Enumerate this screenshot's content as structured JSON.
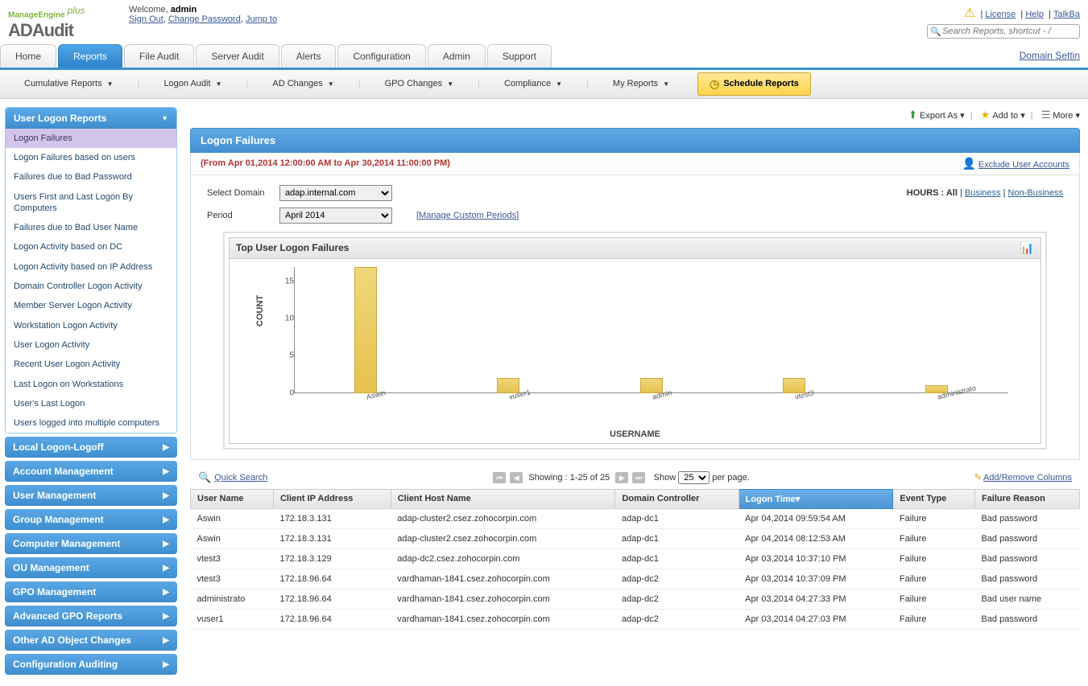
{
  "header": {
    "logo_top": "ManageEngine",
    "logo_main": "ADAudit",
    "logo_plus": "plus",
    "welcome_prefix": "Welcome, ",
    "welcome_user": "admin",
    "sign_out": "Sign Out",
    "change_pw": "Change Password",
    "jump_to": "Jump to",
    "top_links": {
      "license": "License",
      "help": "Help",
      "talkback": "TalkBa"
    },
    "search_placeholder": "Search Reports, shortcut - /"
  },
  "main_tabs": {
    "items": [
      "Home",
      "Reports",
      "File Audit",
      "Server Audit",
      "Alerts",
      "Configuration",
      "Admin",
      "Support"
    ],
    "active_index": 1,
    "right_link": "Domain Settin"
  },
  "sub_toolbar": {
    "items": [
      "Cumulative Reports",
      "Logon Audit",
      "AD Changes",
      "GPO Changes",
      "Compliance",
      "My Reports"
    ],
    "schedule": "Schedule Reports"
  },
  "sidebar": {
    "main_head": "User Logon Reports",
    "items": [
      "Logon Failures",
      "Logon Failures based on users",
      "Failures due to Bad Password",
      "Users First and Last Logon By Computers",
      "Failures due to Bad User Name",
      "Logon Activity based on DC",
      "Logon Activity based on IP Address",
      "Domain Controller Logon Activity",
      "Member Server Logon Activity",
      "Workstation Logon Activity",
      "User Logon Activity",
      "Recent User Logon Activity",
      "Last Logon on Workstations",
      "User's Last Logon",
      "Users logged into multiple computers"
    ],
    "active_index": 0,
    "cats": [
      "Local Logon-Logoff",
      "Account Management",
      "User Management",
      "Group Management",
      "Computer Management",
      "OU Management",
      "GPO Management",
      "Advanced GPO Reports",
      "Other AD Object Changes",
      "Configuration Auditing"
    ]
  },
  "top_actions": {
    "export": "Export As",
    "addto": "Add to",
    "more": "More"
  },
  "content": {
    "title": "Logon Failures",
    "range": "(From Apr 01,2014 12:00:00 AM to Apr 30,2014 11:00:00 PM)",
    "exclude": "Exclude User Accounts"
  },
  "filters": {
    "domain_label": "Select Domain",
    "domain_value": "adap.internal.com",
    "period_label": "Period",
    "period_value": "April 2014",
    "mcp": "[Manage Custom Periods]",
    "hours_prefix": "HOURS : All",
    "business": "Business",
    "nonbusiness": "Non-Business"
  },
  "chart_data": {
    "type": "bar",
    "title": "Top User Logon Failures",
    "xlabel": "USERNAME",
    "ylabel": "COUNT",
    "ylim": [
      0,
      17
    ],
    "y_ticks": [
      0,
      5,
      10,
      15
    ],
    "categories": [
      "Aswin",
      "vuser1",
      "admin",
      "vtest3",
      "administrato"
    ],
    "values": [
      17,
      2,
      2,
      2,
      1
    ]
  },
  "table_toolbar": {
    "quick_search": "Quick Search",
    "showing": "Showing : ",
    "range_text": "1-25 of 25",
    "show_label": "Show",
    "perpage_value": "25",
    "perpage_suffix": " per page.",
    "addremove": "Add/Remove Columns"
  },
  "table": {
    "columns": [
      "User Name",
      "Client IP Address",
      "Client Host Name",
      "Domain Controller",
      "Logon Time▾",
      "Event Type",
      "Failure Reason"
    ],
    "sorted_col": 4,
    "rows": [
      [
        "Aswin",
        "172.18.3.131",
        "adap-cluster2.csez.zohocorpin.com",
        "adap-dc1",
        "Apr 04,2014 09:59:54 AM",
        "Failure",
        "Bad password"
      ],
      [
        "Aswin",
        "172.18.3.131",
        "adap-cluster2.csez.zohocorpin.com",
        "adap-dc1",
        "Apr 04,2014 08:12:53 AM",
        "Failure",
        "Bad password"
      ],
      [
        "vtest3",
        "172.18.3.129",
        "adap-dc2.csez.zohocorpin.com",
        "adap-dc1",
        "Apr 03,2014 10:37:10 PM",
        "Failure",
        "Bad password"
      ],
      [
        "vtest3",
        "172.18.96.64",
        "vardhaman-1841.csez.zohocorpin.com",
        "adap-dc2",
        "Apr 03,2014 10:37:09 PM",
        "Failure",
        "Bad password"
      ],
      [
        "administrato",
        "172.18.96.64",
        "vardhaman-1841.csez.zohocorpin.com",
        "adap-dc2",
        "Apr 03,2014 04:27:33 PM",
        "Failure",
        "Bad user name"
      ],
      [
        "vuser1",
        "172.18.96.64",
        "vardhaman-1841.csez.zohocorpin.com",
        "adap-dc2",
        "Apr 03,2014 04:27:03 PM",
        "Failure",
        "Bad password"
      ]
    ]
  }
}
